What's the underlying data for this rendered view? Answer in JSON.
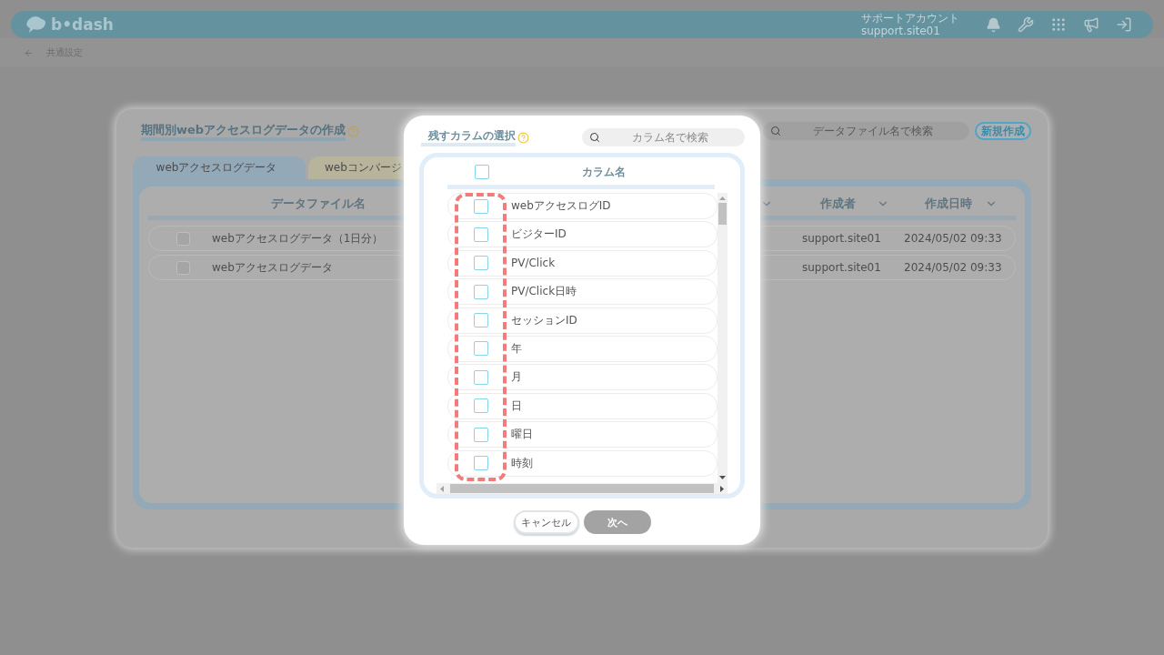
{
  "header": {
    "logo": "b•dash",
    "account_label": "サポートアカウント",
    "account_id": "support.site01"
  },
  "breadcrumb": {
    "label": "共通設定"
  },
  "background_panel": {
    "title": "期間別webアクセスログデータの作成",
    "search": {
      "placeholder": "データファイル名で検索"
    },
    "new_button": "新規作成",
    "tabs": [
      {
        "label": "webアクセスログデータ",
        "selected": true
      },
      {
        "label": "webコンバージ",
        "selected": false
      }
    ],
    "table": {
      "columns": [
        {
          "label": "データファイル名"
        },
        {
          "label": "作成者"
        },
        {
          "label": "作成日時"
        }
      ],
      "rows": [
        {
          "name": "webアクセスログデータ（1日分）",
          "author": "support.site01",
          "created": "2024/05/02 09:33",
          "checked": false
        },
        {
          "name": "webアクセスログデータ",
          "author": "support.site01",
          "created": "2024/05/02 09:33",
          "checked": false
        }
      ]
    }
  },
  "dialog": {
    "title": "残すカラムの選択",
    "search": {
      "placeholder": "カラム名で検索"
    },
    "column_header": "カラム名",
    "select_all_checked": false,
    "columns": [
      {
        "label": "webアクセスログID",
        "checked": false
      },
      {
        "label": "ビジターID",
        "checked": false
      },
      {
        "label": "PV/Click",
        "checked": false
      },
      {
        "label": "PV/Click日時",
        "checked": false
      },
      {
        "label": "セッションID",
        "checked": false
      },
      {
        "label": "年",
        "checked": false
      },
      {
        "label": "月",
        "checked": false
      },
      {
        "label": "日",
        "checked": false
      },
      {
        "label": "曜日",
        "checked": false
      },
      {
        "label": "時刻",
        "checked": false
      }
    ],
    "buttons": [
      {
        "label": "キャンセル",
        "kind": "secondary",
        "disabled": false
      },
      {
        "label": "次へ",
        "kind": "primary",
        "disabled": true
      }
    ]
  }
}
